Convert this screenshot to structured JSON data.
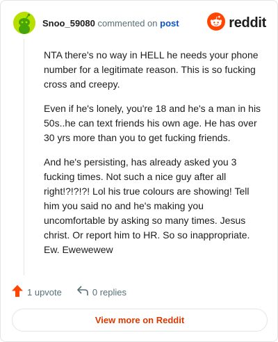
{
  "comment": {
    "username": "Snoo_59080",
    "action_text": "commented on",
    "post_link_text": "post",
    "paragraphs": [
      "NTA there's no way in HELL he needs your phone number for a legitimate reason. This is so fucking cross and creepy.",
      "Even if he's lonely, you're 18 and he's a man in his 50s..he can text friends his own age. He has over 30 yrs more than you to get fucking friends.",
      "And he's persisting, has already asked you 3 fucking times. Not such a nice guy after all right!?!?!?! Lol his true colours are showing! Tell him you said no and he's making you uncomfortable by asking so many times. Jesus christ. Or report him to HR. So so inappropriate. Ew. Ewewewew"
    ],
    "upvotes_label": "1 upvote",
    "replies_label": "0 replies"
  },
  "brand": {
    "wordmark": "reddit",
    "color": "#ff4500"
  },
  "view_more_label": "View more on Reddit",
  "icons": {
    "avatar": "snoo-avatar-icon",
    "logo": "reddit-alien-icon",
    "upvote": "upvote-arrow-icon",
    "reply": "reply-arrow-icon"
  },
  "colors": {
    "upvote": "#ff4500",
    "view_more_text": "#d93900",
    "link": "#0a52cc",
    "meta_text": "#576f76"
  }
}
